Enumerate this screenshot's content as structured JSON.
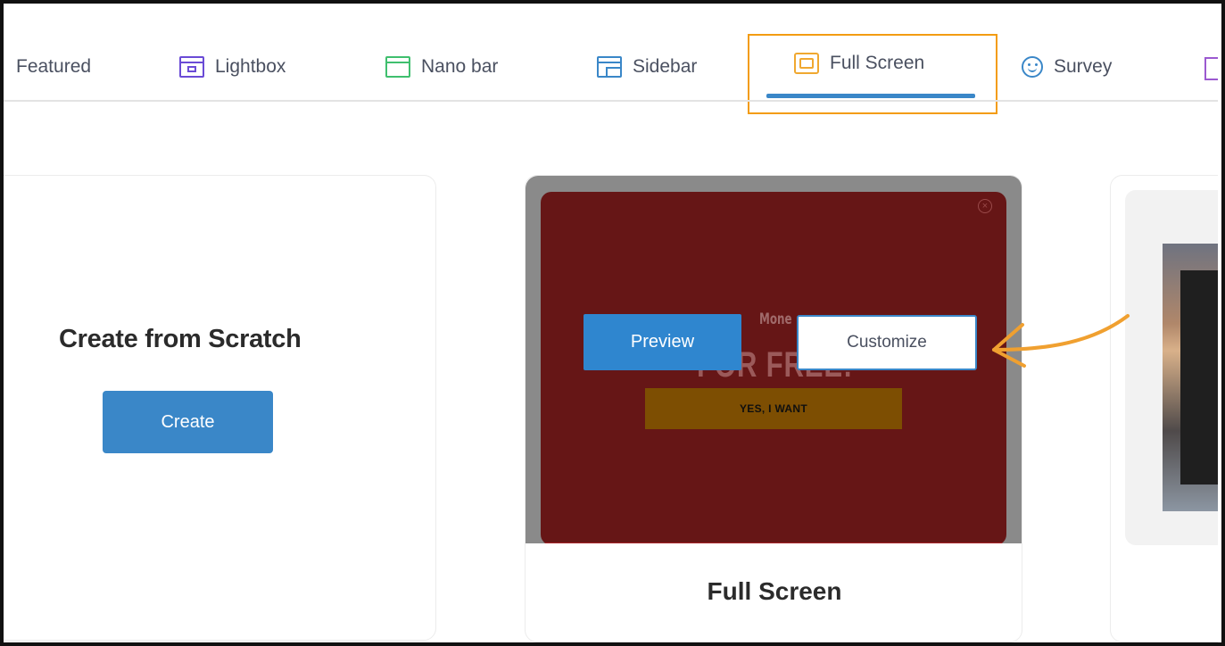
{
  "tabs": [
    {
      "label": "Featured",
      "icon": "none"
    },
    {
      "label": "Lightbox",
      "icon": "lightbox-icon"
    },
    {
      "label": "Nano bar",
      "icon": "nano-bar-icon"
    },
    {
      "label": "Sidebar",
      "icon": "sidebar-icon"
    },
    {
      "label": "Full Screen",
      "icon": "full-screen-icon",
      "active": true
    },
    {
      "label": "Survey",
      "icon": "survey-icon"
    }
  ],
  "scratch": {
    "title": "Create from Scratch",
    "button": "Create"
  },
  "template": {
    "title": "Full Screen",
    "preview_button": "Preview",
    "customize_button": "Customize",
    "popup": {
      "headline_1": "Mone",
      "headline_2": "FOR FREE!",
      "cta": "YES, I WANT"
    }
  },
  "colors": {
    "accent": "#3a87c8",
    "highlight": "#f39c12",
    "popup_bg": "#661616"
  }
}
